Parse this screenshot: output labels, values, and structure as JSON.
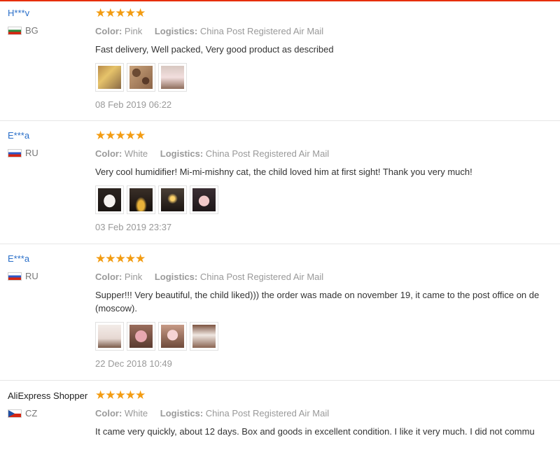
{
  "stars_glyph": "★★★★★",
  "labels": {
    "color": "Color:",
    "logistics": "Logistics:"
  },
  "reviews": [
    {
      "user": "H***v",
      "country": "BG",
      "color": "Pink",
      "logistics": "China Post Registered Air Mail",
      "text": "Fast delivery, Well packed, Very good product as described",
      "text2": "",
      "photos": [
        "photo-1",
        "photo-2",
        "photo-3"
      ],
      "date": "08 Feb 2019 06:22"
    },
    {
      "user": "E***a",
      "country": "RU",
      "color": "White",
      "logistics": "China Post Registered Air Mail",
      "text": "Very cool humidifier! Mi-mi-mishny cat, the child loved him at first sight! Thank you very much!",
      "text2": "",
      "photos": [
        "photo-1",
        "photo-2",
        "photo-3",
        "photo-4"
      ],
      "date": "03 Feb 2019 23:37"
    },
    {
      "user": "E***a",
      "country": "RU",
      "color": "Pink",
      "logistics": "China Post Registered Air Mail",
      "text": "Supper!!! Very beautiful, the child liked))) the order was made on november 19, it came to the post office on de",
      "text2": "(moscow).",
      "photos": [
        "photo-1",
        "photo-2",
        "photo-3",
        "photo-4"
      ],
      "date": "22 Dec 2018 10:49"
    },
    {
      "user": "AliExpress Shopper",
      "country": "CZ",
      "color": "White",
      "logistics": "China Post Registered Air Mail",
      "text": "It came very quickly, about 12 days. Box and goods in excellent condition. I like it very much. I did not commu",
      "text2": "",
      "photos": [],
      "date": ""
    }
  ],
  "colors": {
    "accent_bar": "#e62e04",
    "star": "#f39c12",
    "username": "#2a6fc9"
  }
}
